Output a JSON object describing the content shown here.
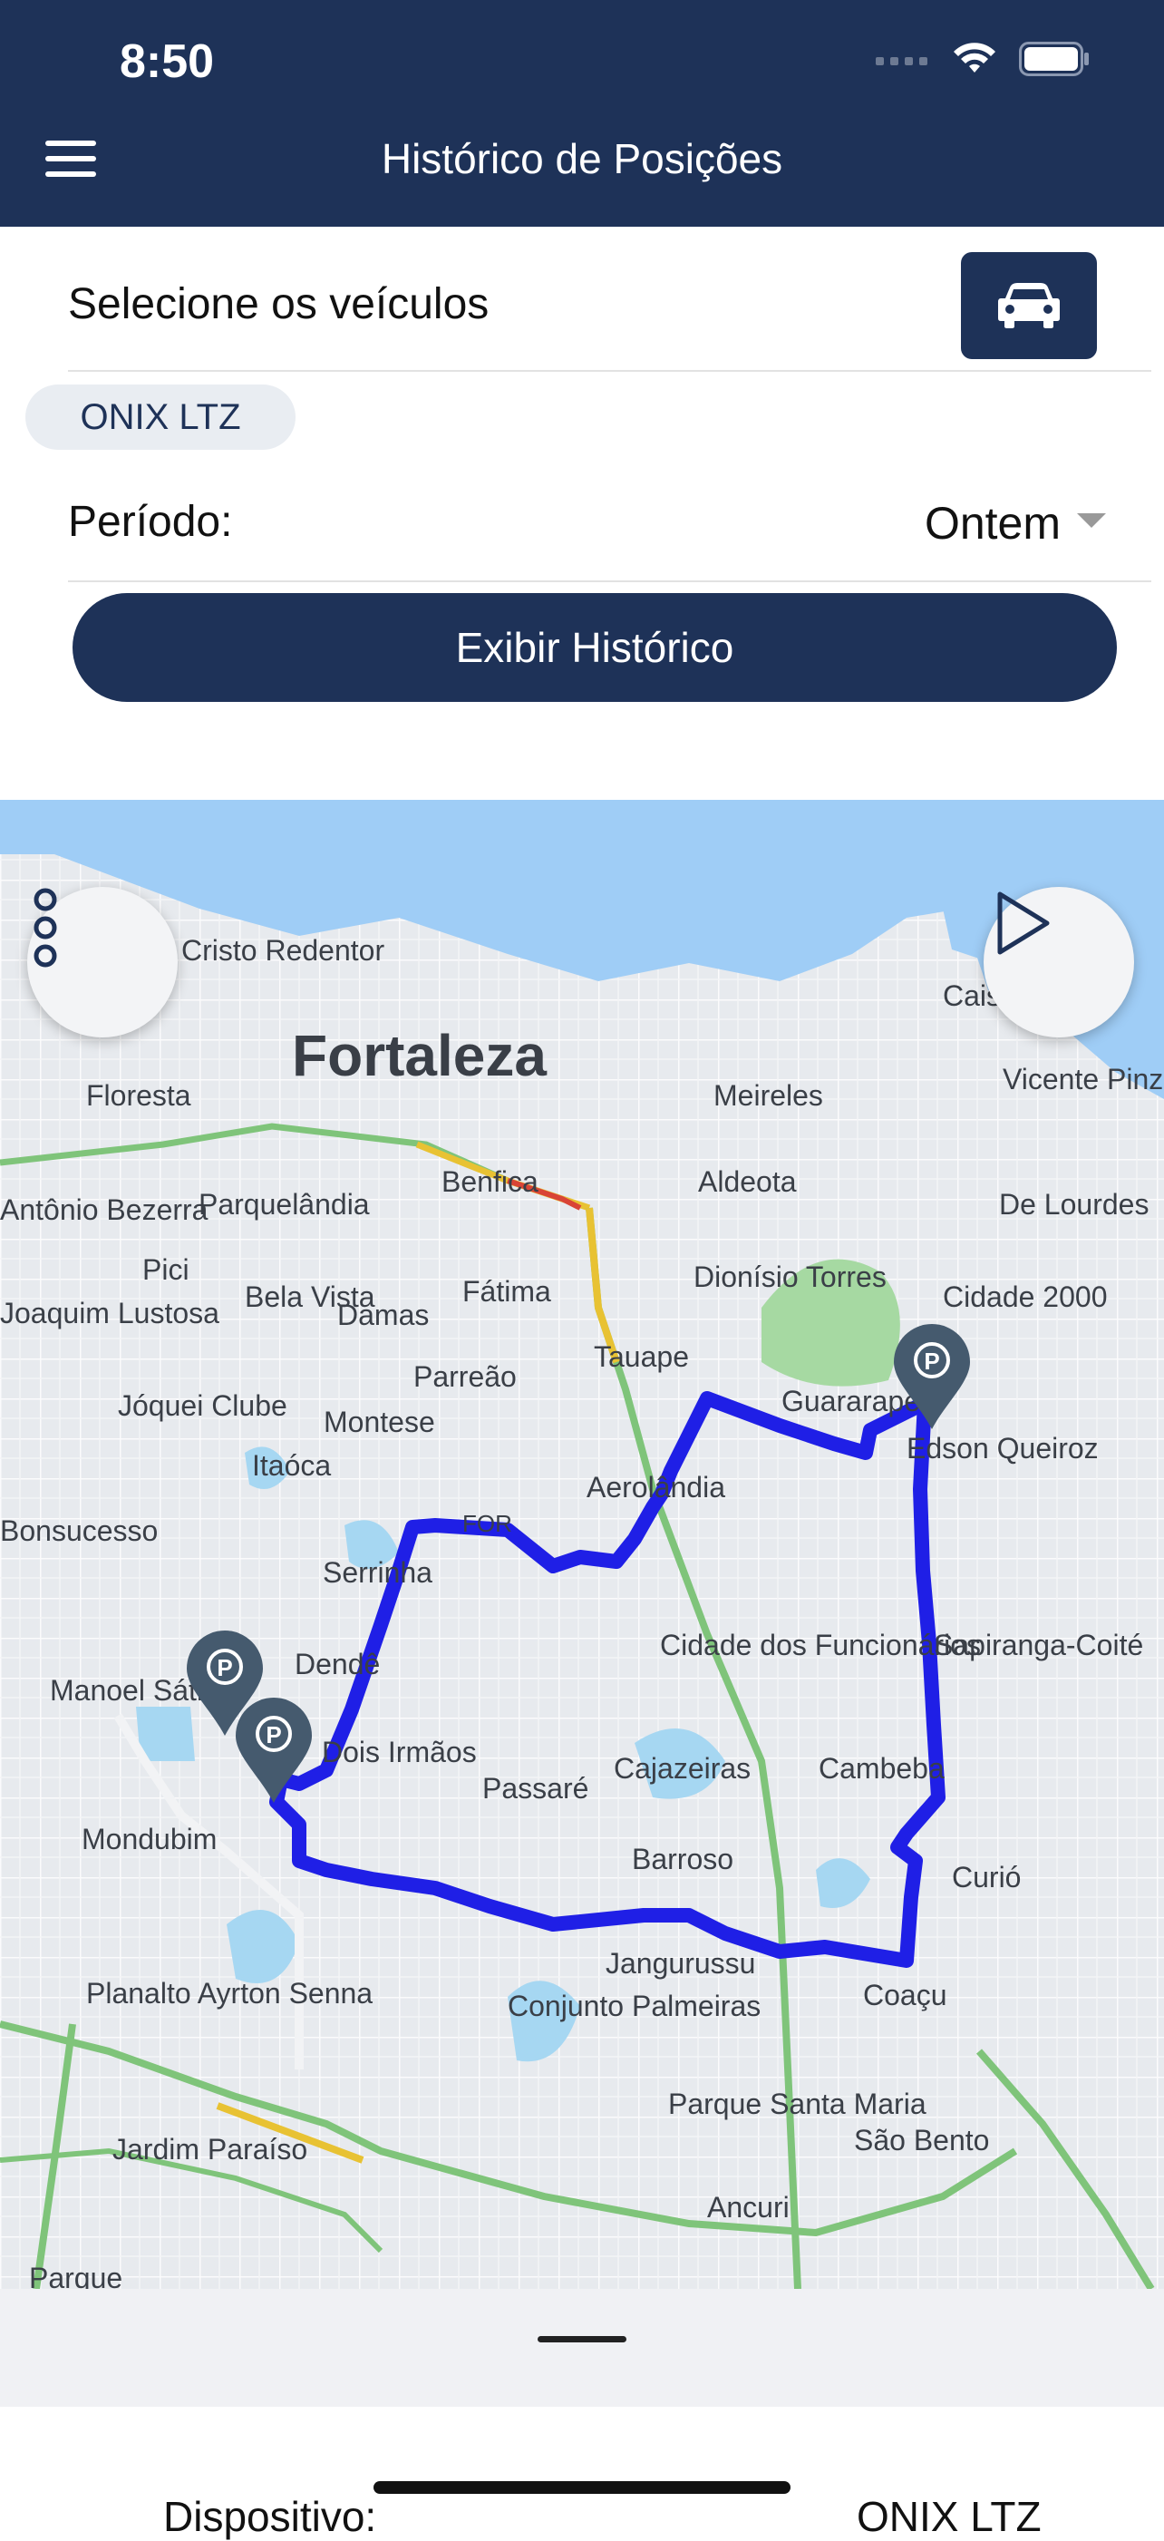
{
  "status_bar": {
    "time": "8:50"
  },
  "header": {
    "title": "Histórico de Posições"
  },
  "vehicle_selector": {
    "label": "Selecione os veículos",
    "selected_chip": "ONIX LTZ"
  },
  "period": {
    "label": "Período:",
    "value": "Ontem"
  },
  "actions": {
    "show_history": "Exibir Histórico"
  },
  "map": {
    "city_label": "Fortaleza",
    "labels": [
      "Cristo Redentor",
      "Floresta",
      "Meireles",
      "Vicente Pinzon",
      "Cais Porto",
      "Aldeota",
      "Benfica",
      "Parquelândia",
      "Antônio Bezerra",
      "De Lourdes",
      "Pici",
      "Bela Vista",
      "Fátima",
      "Damas",
      "Dionísio Torres",
      "Cidade 2000",
      "Joaquim Lustosa",
      "Parreão",
      "Tauape",
      "Jóquei Clube",
      "Montese",
      "Guararapes",
      "Edson Queiroz",
      "Itaóca",
      "Bonsucesso",
      "Aerolândia",
      "Serrinha",
      "Dendê",
      "Manoel Sátiro",
      "Cidade dos Funcionários",
      "Sapiranga-Coité",
      "Dois Irmãos",
      "Passaré",
      "Cajazeiras",
      "Cambeba",
      "Mondubim",
      "Barroso",
      "Curió",
      "Jangurussu",
      "Coaçu",
      "Planalto Ayrton Senna",
      "Conjunto Palmeiras",
      "Parque Santa Maria",
      "São Bento",
      "Jardim Paraíso",
      "Ancuri",
      "Parque",
      "FOR"
    ],
    "route_color": "#1f1fe6"
  },
  "bottom_sheet": {
    "device_label": "Dispositivo:",
    "device_value": "ONIX LTZ"
  }
}
